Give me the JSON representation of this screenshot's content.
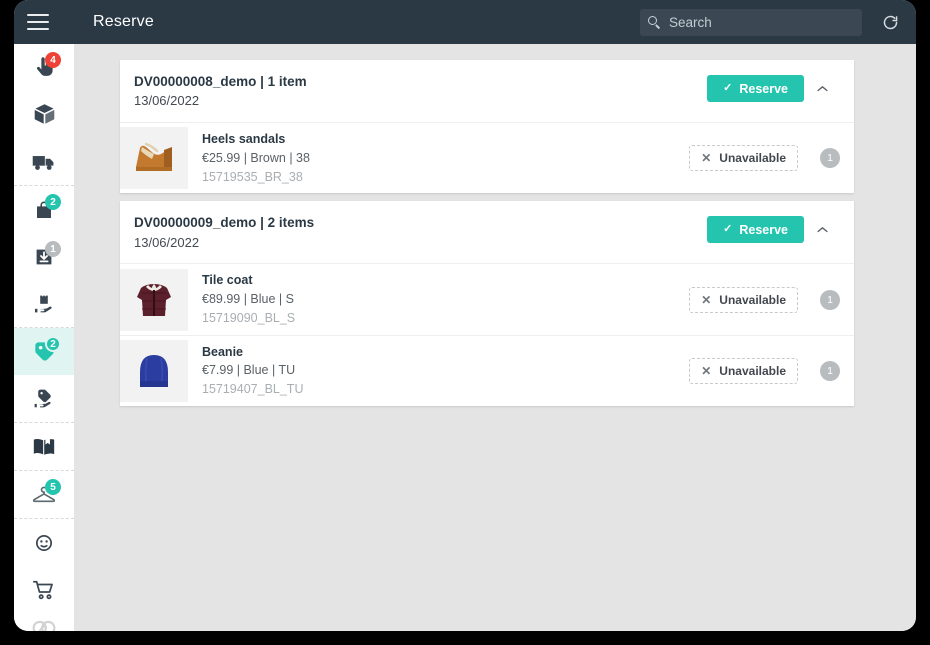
{
  "window": {
    "app_title": "Reserve"
  },
  "topbar": {
    "menu_icon": "hamburger-icon",
    "search": {
      "placeholder": "Search",
      "value": "",
      "icon": "search-icon"
    },
    "refresh_icon": "refresh-icon",
    "background": "#2b3945"
  },
  "colors": {
    "accent_teal": "#25c4ae",
    "badge_red": "#ef4136",
    "badge_gray": "#b9bcbf",
    "active_bg": "#e0f5f2",
    "page_bg": "#e4e4e4",
    "topbar": "#2b3945"
  },
  "sidebar": {
    "groups": [
      {
        "items": [
          {
            "icon": "hand-click-icon",
            "badge": "4",
            "badge_color": "#ef4136",
            "active": false
          },
          {
            "icon": "package-box-icon",
            "badge": null,
            "badge_color": null,
            "active": false
          },
          {
            "icon": "delivery-truck-icon",
            "badge": null,
            "badge_color": null,
            "active": false
          }
        ]
      },
      {
        "items": [
          {
            "icon": "bag-pickup-icon",
            "badge": "2",
            "badge_color": "#25c4ae",
            "active": false
          },
          {
            "icon": "inbox-download-icon",
            "badge": "1",
            "badge_color": "#b9bcbf",
            "active": false
          },
          {
            "icon": "hand-holding-bag-icon",
            "badge": null,
            "badge_color": null,
            "active": false
          }
        ]
      },
      {
        "items": [
          {
            "icon": "tag-reserve-icon",
            "badge": "2",
            "badge_color": "#25c4ae",
            "active": true
          },
          {
            "icon": "hand-holding-tag-icon",
            "badge": null,
            "badge_color": null,
            "active": false
          }
        ]
      },
      {
        "items": [
          {
            "icon": "catalog-book-icon",
            "badge": null,
            "badge_color": null,
            "active": false
          }
        ]
      },
      {
        "items": [
          {
            "icon": "hanger-icon",
            "badge": "5",
            "badge_color": "#25c4ae",
            "active": false
          }
        ]
      },
      {
        "items": [
          {
            "icon": "customer-face-icon",
            "badge": null,
            "badge_color": null,
            "active": false
          },
          {
            "icon": "shopping-cart-icon",
            "badge": null,
            "badge_color": null,
            "active": false
          }
        ]
      }
    ],
    "brand_logo_icon": "brand-logo-icon"
  },
  "main": {
    "orders": [
      {
        "title": "DV00000008_demo | 1 item",
        "reference": "DV00000008_demo",
        "item_count_label": "1 item",
        "date": "13/06/2022",
        "reserve_label": "Reserve",
        "collapse_icon": "chevron-up-icon",
        "items": [
          {
            "name": "Heels sandals",
            "attributes": "€25.99 | Brown | 38",
            "price": "€25.99",
            "color": "Brown",
            "size": "38",
            "sku": "15719535_BR_38",
            "action_label": "Unavailable",
            "quantity": "1",
            "thumb": "heels-sandals-photo"
          }
        ]
      },
      {
        "title": "DV00000009_demo | 2 items",
        "reference": "DV00000009_demo",
        "item_count_label": "2 items",
        "date": "13/06/2022",
        "reserve_label": "Reserve",
        "collapse_icon": "chevron-up-icon",
        "items": [
          {
            "name": "Tile coat",
            "attributes": "€89.99 | Blue | S",
            "price": "€89.99",
            "color": "Blue",
            "size": "S",
            "sku": "15719090_BL_S",
            "action_label": "Unavailable",
            "quantity": "1",
            "thumb": "tile-coat-photo"
          },
          {
            "name": "Beanie",
            "attributes": "€7.99 | Blue | TU",
            "price": "€7.99",
            "color": "Blue",
            "size": "TU",
            "sku": "15719407_BL_TU",
            "action_label": "Unavailable",
            "quantity": "1",
            "thumb": "beanie-photo"
          }
        ]
      }
    ]
  }
}
